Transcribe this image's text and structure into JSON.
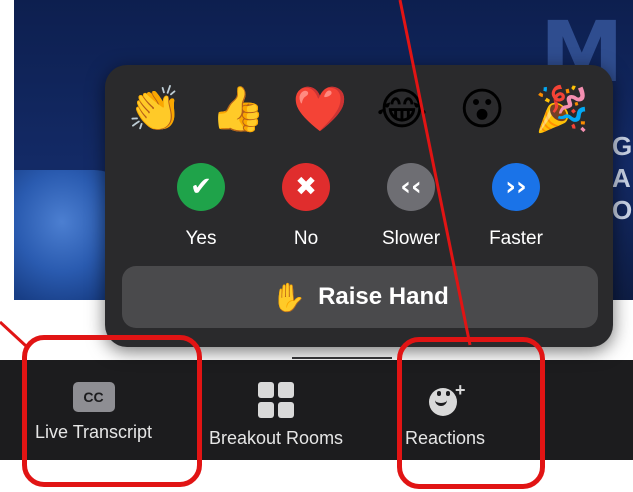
{
  "toolbar": {
    "items": [
      {
        "label": "Live Transcript",
        "icon": "cc-icon",
        "icon_text": "CC"
      },
      {
        "label": "Breakout Rooms",
        "icon": "grid-icon"
      },
      {
        "label": "Reactions",
        "icon": "add-reaction-icon"
      }
    ]
  },
  "reactions_popup": {
    "emojis": [
      {
        "name": "clapping-hands-emoji",
        "glyph": "👏"
      },
      {
        "name": "thumbs-up-emoji",
        "glyph": "👍"
      },
      {
        "name": "heart-emoji",
        "glyph": "❤️"
      },
      {
        "name": "tears-of-joy-emoji",
        "glyph": "😂"
      },
      {
        "name": "open-mouth-emoji",
        "glyph": "😮"
      },
      {
        "name": "party-popper-emoji",
        "glyph": "🎉"
      }
    ],
    "feedback": [
      {
        "label": "Yes",
        "glyph": "✔",
        "color": "#1fa34a"
      },
      {
        "label": "No",
        "glyph": "✖",
        "color": "#e02d2d"
      },
      {
        "label": "Slower",
        "glyph": "‹‹",
        "color": "#6e6e73"
      },
      {
        "label": "Faster",
        "glyph": "››",
        "color": "#1a73e8"
      }
    ],
    "raise_hand": {
      "label": "Raise Hand",
      "glyph": "✋"
    }
  },
  "background": {
    "logo_letter": "M",
    "side_text": "G\nA\nOF"
  },
  "colors": {
    "annotation_red": "#e11414",
    "toolbar_bg": "#1c1c1e",
    "popup_bg": "#2a2a2c"
  }
}
